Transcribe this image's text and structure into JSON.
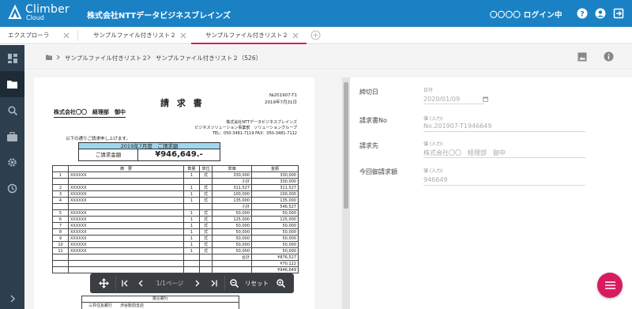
{
  "header": {
    "logo_line1": "Climber",
    "logo_line2": "Cloud",
    "company": "株式会社NTTデータビジネスブレインズ",
    "login_status": "〇〇〇〇 ログイン中",
    "bg_color": "#1a82c4"
  },
  "tabs": [
    {
      "label": "エクスプローラ"
    },
    {
      "label": "サンプルファイル付きリスト２"
    },
    {
      "label": "サンプルファイル付きリスト２",
      "active": true
    }
  ],
  "sidebar": {
    "items": [
      "dashboard-icon",
      "folder-icon",
      "search-icon",
      "briefcase-icon",
      "gear-icon",
      "history-icon"
    ]
  },
  "breadcrumb": {
    "item1": "サンプルファイル付きリスト２",
    "item2": "サンプルファイル付きリスト２（526）"
  },
  "document": {
    "title": "請 求 書",
    "number": "№201907-T1",
    "date": "2019年7月31日",
    "addressee": "株式会社〇〇　経理部　御中",
    "from_line1": "株式会社NTTデータビジネスブレインズ",
    "from_line2": "ビジネスソリューション事業部　ソリューショングループ",
    "from_line3": "TEL：050-3481-7119 FAX：050-3481-7112",
    "note": "以下の通りご請求申し上げます。",
    "band_label": "2019年7月度　ご請求額",
    "total_label": "ご請求金額",
    "total_value": "¥946,649.-",
    "table_headers": [
      "",
      "摘　要",
      "数量",
      "単位",
      "単価",
      "金額"
    ],
    "rows": [
      {
        "no": "1",
        "desc": "XXXXXX",
        "qty": "1",
        "unit": "式",
        "price": "330,000",
        "amount": "330,000"
      },
      {
        "no": "",
        "desc": "",
        "qty": "",
        "unit": "",
        "price": "小計",
        "amount": "330,000"
      },
      {
        "no": "2",
        "desc": "XXXXXX",
        "qty": "1",
        "unit": "式",
        "price": "311,527",
        "amount": "311,527"
      },
      {
        "no": "3",
        "desc": "XXXXXX",
        "qty": "1",
        "unit": "式",
        "price": "100,000",
        "amount": "100,000"
      },
      {
        "no": "4",
        "desc": "XXXXXX",
        "qty": "1",
        "unit": "式",
        "price": "135,000",
        "amount": "135,000"
      },
      {
        "no": "",
        "desc": "",
        "qty": "",
        "unit": "",
        "price": "小計",
        "amount": "546,527"
      },
      {
        "no": "5",
        "desc": "XXXXXX",
        "qty": "1",
        "unit": "式",
        "price": "50,000",
        "amount": "50,000"
      },
      {
        "no": "6",
        "desc": "XXXXXX",
        "qty": "1",
        "unit": "式",
        "price": "125,000",
        "amount": "125,000"
      },
      {
        "no": "7",
        "desc": "XXXXXX",
        "qty": "1",
        "unit": "式",
        "price": "50,000",
        "amount": "50,000"
      },
      {
        "no": "8",
        "desc": "XXXXXX",
        "qty": "1",
        "unit": "式",
        "price": "50,000",
        "amount": "50,000"
      },
      {
        "no": "9",
        "desc": "XXXXXX",
        "qty": "1",
        "unit": "式",
        "price": "50,000",
        "amount": "50,000"
      },
      {
        "no": "10",
        "desc": "XXXXXX",
        "qty": "1",
        "unit": "式",
        "price": "50,000",
        "amount": "50,000"
      },
      {
        "no": "11",
        "desc": "XXXXXX",
        "qty": "1",
        "unit": "式",
        "price": "50,000",
        "amount": "50,000"
      },
      {
        "no": "",
        "desc": "",
        "qty": "",
        "unit": "",
        "price": "合計",
        "amount": "¥876,527"
      },
      {
        "no": "",
        "desc": "",
        "qty": "",
        "unit": "",
        "price": "",
        "amount": "¥70,122"
      },
      {
        "no": "",
        "desc": "",
        "qty": "",
        "unit": "",
        "price": "",
        "amount": "¥946,649"
      }
    ],
    "bank_label": "振込銀行",
    "bank_detail1": "三井住友銀行",
    "bank_detail2": "渋谷駅前支店"
  },
  "viewer_toolbar": {
    "page_label": "1/1ページ",
    "reset_label": "リセット"
  },
  "form": {
    "fields": [
      {
        "label": "締切日",
        "sub": "日付",
        "value": "2020/01/09"
      },
      {
        "label": "請求書No",
        "sub": "値 (入力)",
        "value": "No.201907-T1946649"
      },
      {
        "label": "請求先",
        "sub": "値 (入力)",
        "value": "株式会社〇〇　経理部　御中"
      },
      {
        "label": "今回御請求額",
        "sub": "値 (入力)",
        "value": "946649"
      }
    ]
  },
  "colors": {
    "accent": "#d81b60",
    "sidebar": "#2d3e4f"
  }
}
